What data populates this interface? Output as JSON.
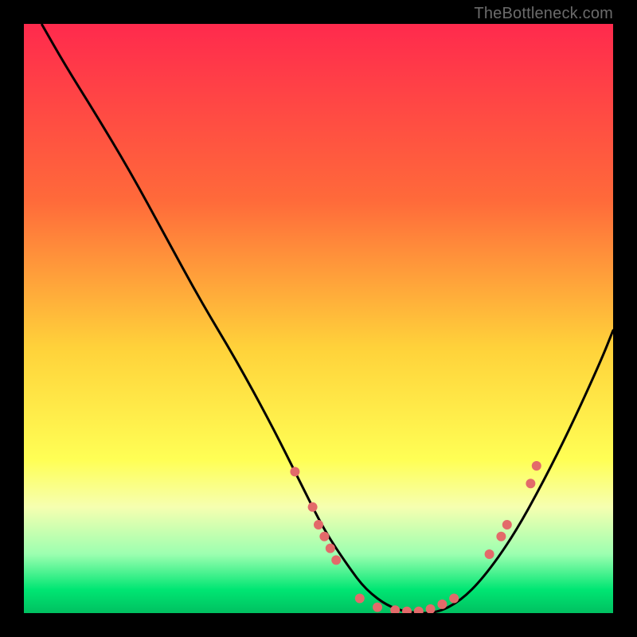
{
  "watermark": "TheBottleneck.com",
  "chart_data": {
    "type": "line",
    "title": "",
    "xlabel": "",
    "ylabel": "",
    "xlim": [
      0,
      100
    ],
    "ylim": [
      0,
      100
    ],
    "grid": false,
    "legend": false,
    "gradient_stops": [
      {
        "offset": 0,
        "color": "#ff2a4d"
      },
      {
        "offset": 30,
        "color": "#ff6a3a"
      },
      {
        "offset": 55,
        "color": "#ffd23a"
      },
      {
        "offset": 74,
        "color": "#ffff55"
      },
      {
        "offset": 82,
        "color": "#f6ffb0"
      },
      {
        "offset": 90,
        "color": "#9cffb0"
      },
      {
        "offset": 96,
        "color": "#00e673"
      },
      {
        "offset": 100,
        "color": "#00c060"
      }
    ],
    "series": [
      {
        "name": "bottleneck-curve",
        "x": [
          3,
          7,
          12,
          18,
          24,
          30,
          36,
          42,
          47,
          51,
          55,
          58,
          62,
          66,
          70,
          74,
          78,
          83,
          88,
          93,
          98,
          100
        ],
        "y": [
          100,
          93,
          85,
          75,
          64,
          53,
          43,
          32,
          22,
          14,
          8,
          4,
          1,
          0,
          0,
          2,
          6,
          13,
          22,
          32,
          43,
          48
        ]
      }
    ],
    "markers": {
      "name": "highlight-points",
      "color": "#e36a6a",
      "radius": 6,
      "points": [
        {
          "x": 46,
          "y": 24
        },
        {
          "x": 49,
          "y": 18
        },
        {
          "x": 50,
          "y": 15
        },
        {
          "x": 51,
          "y": 13
        },
        {
          "x": 52,
          "y": 11
        },
        {
          "x": 53,
          "y": 9
        },
        {
          "x": 57,
          "y": 2.5
        },
        {
          "x": 60,
          "y": 1
        },
        {
          "x": 63,
          "y": 0.5
        },
        {
          "x": 65,
          "y": 0.3
        },
        {
          "x": 67,
          "y": 0.3
        },
        {
          "x": 69,
          "y": 0.7
        },
        {
          "x": 71,
          "y": 1.5
        },
        {
          "x": 73,
          "y": 2.5
        },
        {
          "x": 79,
          "y": 10
        },
        {
          "x": 81,
          "y": 13
        },
        {
          "x": 82,
          "y": 15
        },
        {
          "x": 86,
          "y": 22
        },
        {
          "x": 87,
          "y": 25
        }
      ]
    }
  }
}
